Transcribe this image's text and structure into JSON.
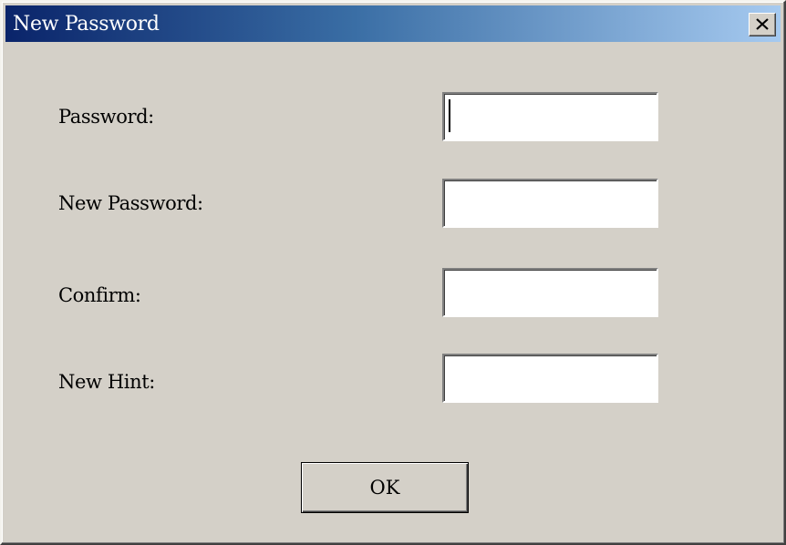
{
  "window": {
    "title": "New Password",
    "close_icon": "close-icon"
  },
  "form": {
    "fields": [
      {
        "label": "Password:",
        "value": ""
      },
      {
        "label": "New Password:",
        "value": ""
      },
      {
        "label": "Confirm:",
        "value": ""
      },
      {
        "label": "New Hint:",
        "value": ""
      }
    ],
    "ok_label": "OK"
  },
  "colors": {
    "title_start": "#0a246a",
    "title_end": "#a6caf0",
    "face": "#d4d0c8"
  }
}
